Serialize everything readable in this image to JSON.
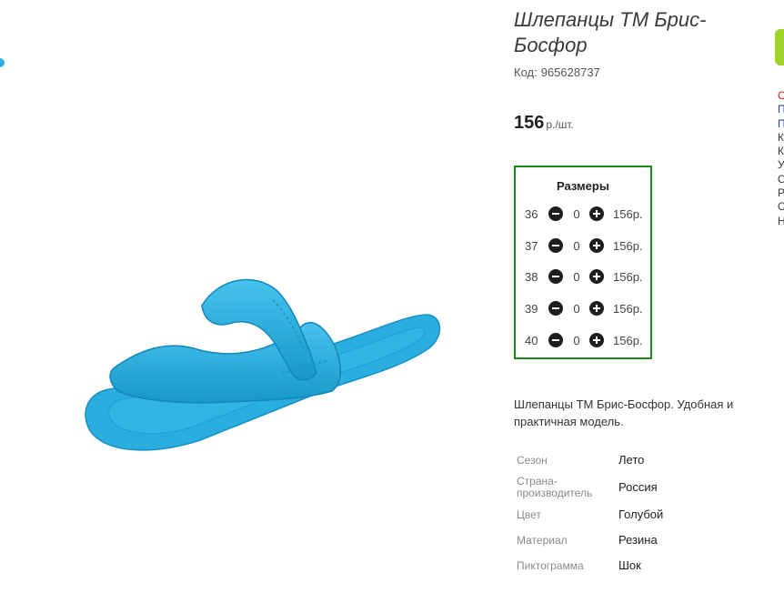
{
  "product": {
    "title": "Шлепанцы ТМ Брис-Босфор",
    "code_label": "Код:",
    "code_value": "965628737",
    "price_value": "156",
    "price_unit": "р./шт."
  },
  "sizes": {
    "title": "Размеры",
    "rows": [
      {
        "size": "36",
        "qty": "0",
        "price": "156р."
      },
      {
        "size": "37",
        "qty": "0",
        "price": "156р."
      },
      {
        "size": "38",
        "qty": "0",
        "price": "156р."
      },
      {
        "size": "39",
        "qty": "0",
        "price": "156р."
      },
      {
        "size": "40",
        "qty": "0",
        "price": "156р."
      }
    ]
  },
  "description": "Шлепанцы ТМ Брис-Босфор. Удобная и практичная модель.",
  "specs": [
    {
      "label": "Сезон",
      "value": "Лето"
    },
    {
      "label": "Страна-производитель",
      "value": "Россия"
    },
    {
      "label": "Цвет",
      "value": "Голубой"
    },
    {
      "label": "Материал",
      "value": "Резина"
    },
    {
      "label": "Пиктограмма",
      "value": "Шок"
    }
  ],
  "right_edge": {
    "letters": [
      "С",
      "П",
      "П",
      "К",
      "К",
      "У",
      "С",
      "Р",
      "С",
      "Н"
    ]
  },
  "colors": {
    "accent_border": "#1b8a1b",
    "slipper": "#2aaee0",
    "red_text": "#d81b1b",
    "link_blue": "#1a3fb0"
  },
  "icons": {
    "qty_decrease": "minus-circle-icon",
    "qty_increase": "plus-circle-icon"
  }
}
